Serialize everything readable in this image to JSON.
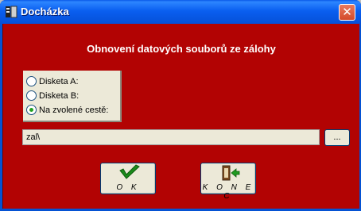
{
  "window": {
    "title": "Docházka",
    "close_label": "✕"
  },
  "dialog": {
    "heading": "Obnovení datových souborů ze zálohy",
    "options": [
      {
        "label": "Disketa A:",
        "checked": false
      },
      {
        "label": "Disketa B:",
        "checked": false
      },
      {
        "label": "Na zvolené cestě:",
        "checked": true
      }
    ],
    "path_value": "zal\\",
    "browse_label": "...",
    "ok_label": "O K",
    "konec_label": "K O N E C"
  },
  "colors": {
    "background": "#b20303",
    "accent": "#0a5ae8",
    "check": "#21a121"
  }
}
